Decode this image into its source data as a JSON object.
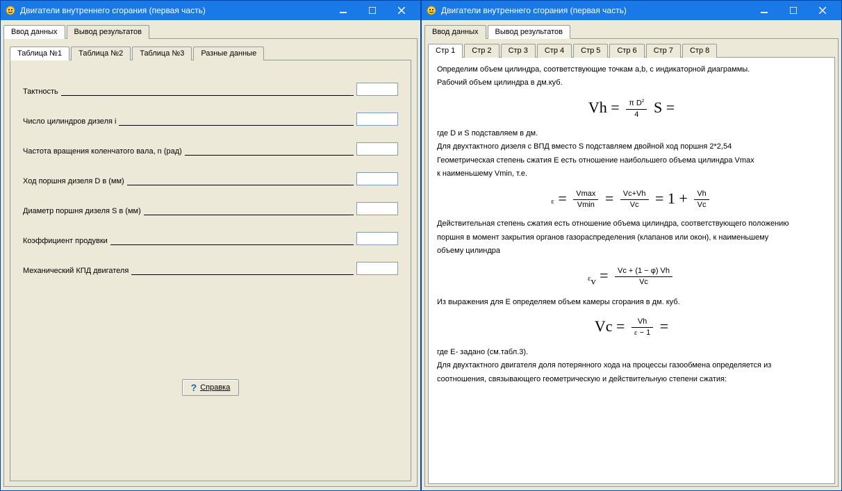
{
  "leftWindow": {
    "title": "Двигатели внутреннего сгорания (первая часть)",
    "mainTabs": {
      "input": "Ввод данных",
      "output": "Вывод результатов"
    },
    "subTabs": {
      "t1": "Таблица №1",
      "t2": "Таблица №2",
      "t3": "Таблица №3",
      "misc": "Разные данные"
    },
    "fields": {
      "f1": "Тактность",
      "f2": "Число цилиндров дизеля i",
      "f3": "Частота вращения коленчатого вала, n  (рад)",
      "f4": "Ход поршня дизеля D в (мм)",
      "f5": "Диаметр поршня дизеля S в (мм)",
      "f6": "Коэффициент продувки",
      "f7": "Механический  КПД двигателя"
    },
    "helpBtn": "Справка"
  },
  "rightWindow": {
    "title": "Двигатели внутреннего сгорания (первая часть)",
    "mainTabs": {
      "input": "Ввод данных",
      "output": "Вывод результатов"
    },
    "pageTabs": {
      "p1": "Стр 1",
      "p2": "Стр 2",
      "p3": "Стр 3",
      "p4": "Стр 4",
      "p5": "Стр 5",
      "p6": "Стр 6",
      "p7": "Стр 7",
      "p8": "Стр 8"
    },
    "text": {
      "l1": "Определим объем цилиндра, соответствующие точкам a,b, с индикаторной диаграммы.",
      "l2": "Рабочий объем цилиндра в дм.куб.",
      "l3": "где D и S подставляем в дм.",
      "l4": "Для двухтактного дизеля с ВПД  вместо S подставляем двойной ход поршня 2*2,54",
      "l5": "Геометрическая степень сжатия E есть отношение наибольшего объема цилиндра Vmax",
      "l6": "к наименьшему Vmin, т.е.",
      "l7": "Действительная степень сжатия есть отношение объема цилиндра, соответствующего положению",
      "l8": "поршня в момент закрытия органов газораспределения (клапанов или окон), к наименьшему",
      "l9": "объему цилиндра",
      "l10": "Из выражения для E определяем объем камеры сгорания в дм. куб.",
      "l11": "где  E- задано (см.табл.3).",
      "l12": "Для двухтактного двигателя доля потерянного хода  на процессы газообмена определяется  из",
      "l13": "соотношения, связывающего геометрическую и действительную степени сжатия:"
    }
  }
}
